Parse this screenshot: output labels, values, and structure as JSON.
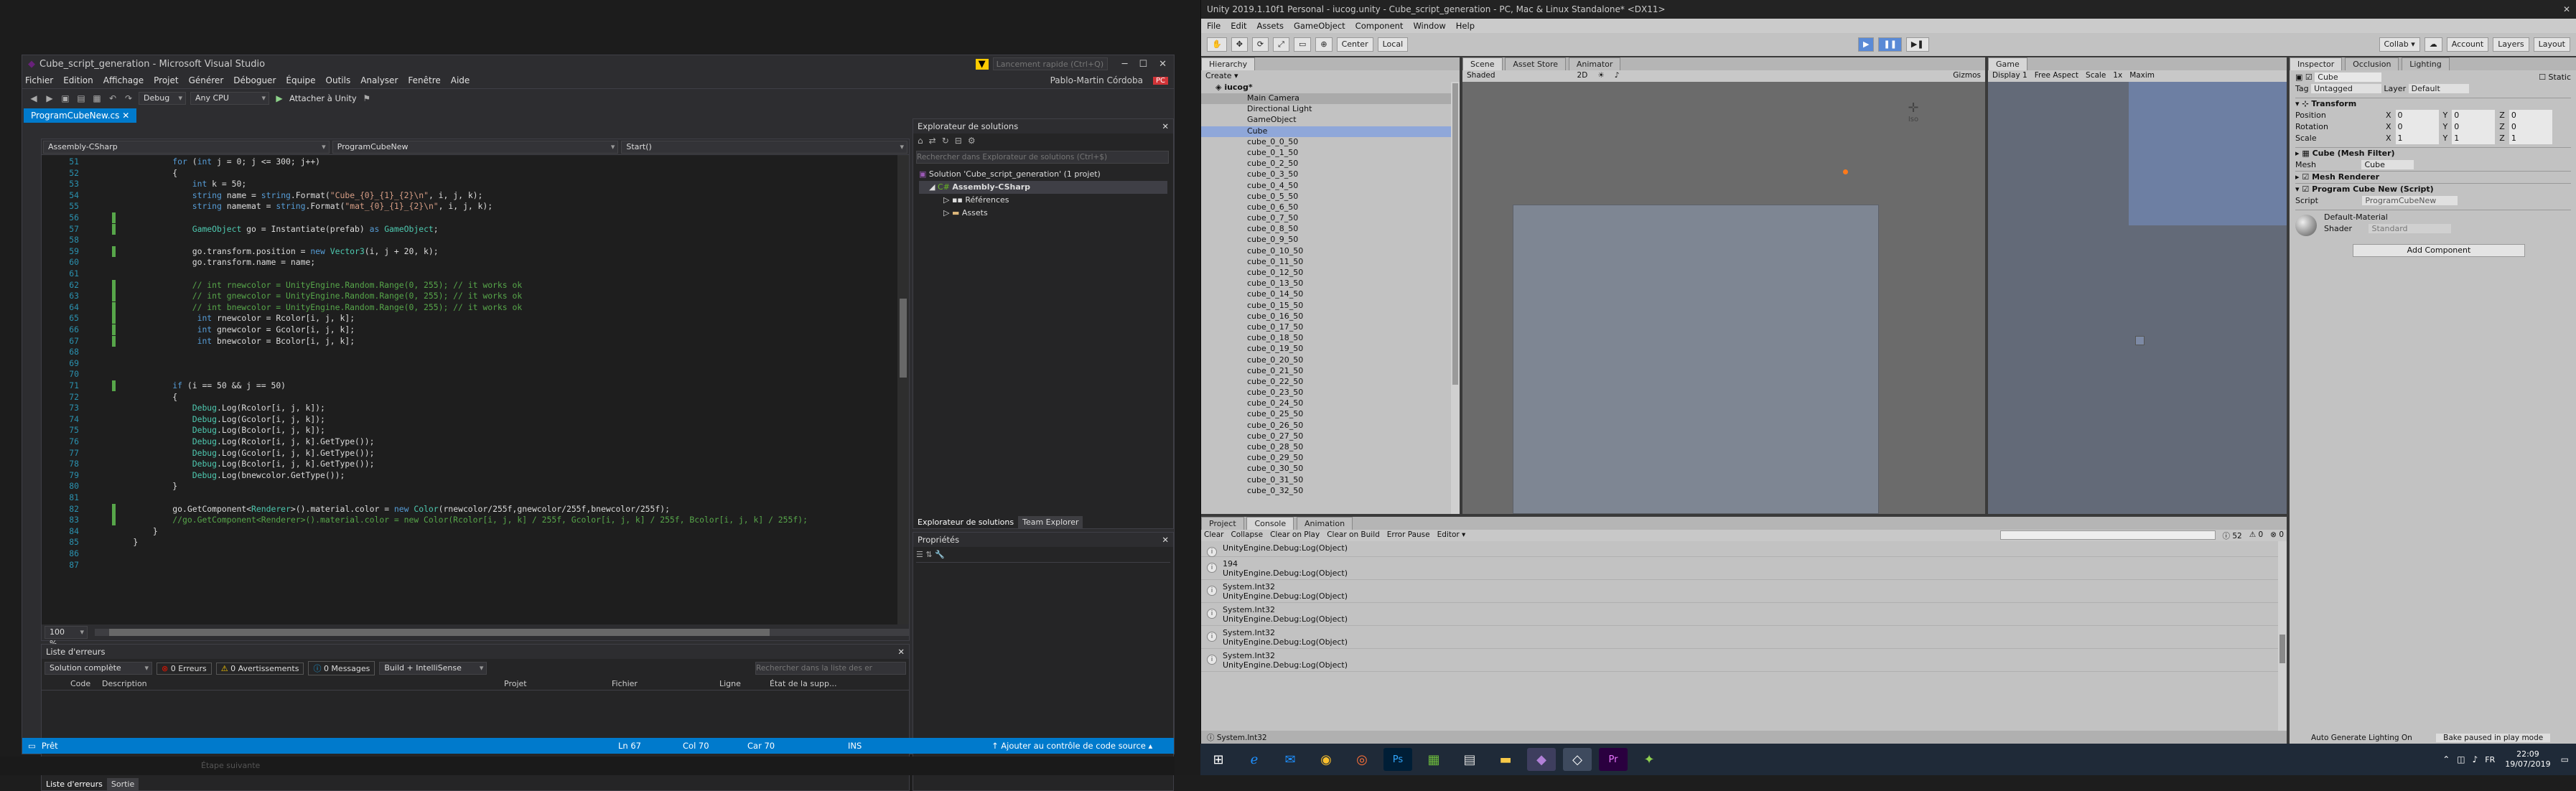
{
  "vs": {
    "title": "Cube_script_generation - Microsoft Visual Studio",
    "user": "Pablo-Martin Córdoba",
    "quicklaunch_placeholder": "Lancement rapide (Ctrl+Q)",
    "menu": [
      "Fichier",
      "Edition",
      "Affichage",
      "Projet",
      "Générer",
      "Déboguer",
      "Équipe",
      "Outils",
      "Analyser",
      "Fenêtre",
      "Aide"
    ],
    "config": "Debug",
    "platform": "Any CPU",
    "attach_label": "Attacher à Unity",
    "doc_tab": "ProgramCubeNew.cs",
    "nav": [
      "Assembly-CSharp",
      "ProgramCubeNew",
      "Start()"
    ],
    "zoom": "100 %",
    "code": [
      {
        "n": "51",
        "t": "            for (int j = 0; j <= 300; j++)"
      },
      {
        "n": "52",
        "t": "            {"
      },
      {
        "n": "53",
        "t": "                int k = 50;"
      },
      {
        "n": "54",
        "t": "                string name = string.Format(\"Cube_{0}_{1}_{2}\\n\", i, j, k);"
      },
      {
        "n": "55",
        "t": "                string namemat = string.Format(\"mat_{0}_{1}_{2}\\n\", i, j, k);"
      },
      {
        "n": "56",
        "t": ""
      },
      {
        "n": "57",
        "t": "                GameObject go = Instantiate(prefab) as GameObject;"
      },
      {
        "n": "58",
        "t": ""
      },
      {
        "n": "59",
        "t": "                go.transform.position = new Vector3(i, j + 20, k);"
      },
      {
        "n": "60",
        "t": "                go.transform.name = name;"
      },
      {
        "n": "61",
        "t": ""
      },
      {
        "n": "62",
        "t": "                // int rnewcolor = UnityEngine.Random.Range(0, 255); // it works ok"
      },
      {
        "n": "63",
        "t": "                // int gnewcolor = UnityEngine.Random.Range(0, 255); // it works ok"
      },
      {
        "n": "64",
        "t": "                // int bnewcolor = UnityEngine.Random.Range(0, 255); // it works ok"
      },
      {
        "n": "65",
        "t": "                 int rnewcolor = Rcolor[i, j, k];"
      },
      {
        "n": "66",
        "t": "                 int gnewcolor = Gcolor[i, j, k];"
      },
      {
        "n": "67",
        "t": "                 int bnewcolor = Bcolor[i, j, k];"
      },
      {
        "n": "68",
        "t": ""
      },
      {
        "n": "69",
        "t": ""
      },
      {
        "n": "70",
        "t": ""
      },
      {
        "n": "71",
        "t": "            if (i == 50 && j == 50)"
      },
      {
        "n": "72",
        "t": "            {"
      },
      {
        "n": "73",
        "t": "                Debug.Log(Rcolor[i, j, k]);"
      },
      {
        "n": "74",
        "t": "                Debug.Log(Gcolor[i, j, k]);"
      },
      {
        "n": "75",
        "t": "                Debug.Log(Bcolor[i, j, k]);"
      },
      {
        "n": "76",
        "t": "                Debug.Log(Rcolor[i, j, k].GetType());"
      },
      {
        "n": "77",
        "t": "                Debug.Log(Gcolor[i, j, k].GetType());"
      },
      {
        "n": "78",
        "t": "                Debug.Log(Bcolor[i, j, k].GetType());"
      },
      {
        "n": "79",
        "t": "                Debug.Log(bnewcolor.GetType());"
      },
      {
        "n": "80",
        "t": "            }"
      },
      {
        "n": "81",
        "t": ""
      },
      {
        "n": "82",
        "t": "            go.GetComponent<Renderer>().material.color = new Color(rnewcolor/255f,gnewcolor/255f,bnewcolor/255f);"
      },
      {
        "n": "83",
        "t": "            //go.GetComponent<Renderer>().material.color = new Color(Rcolor[i, j, k] / 255f, Gcolor[i, j, k] / 255f, Bcolor[i, j, k] / 255f);"
      },
      {
        "n": "84",
        "t": "        }"
      },
      {
        "n": "85",
        "t": "    }"
      },
      {
        "n": "86",
        "t": ""
      },
      {
        "n": "87",
        "t": ""
      }
    ],
    "errors": {
      "title": "Liste d'erreurs",
      "scope": "Solution complète",
      "err_count": "0 Erreurs",
      "warn_count": "0 Avertissements",
      "msg_count": "0 Messages",
      "build": "Build + IntelliSense",
      "search_placeholder": "Rechercher dans la liste des er",
      "columns": [
        "Code",
        "Description",
        "Projet",
        "Fichier",
        "Ligne",
        "État de la supp..."
      ],
      "bottom_tabs": [
        "Liste d'erreurs",
        "Sortie"
      ]
    },
    "solution": {
      "title": "Explorateur de solutions",
      "search_placeholder": "Rechercher dans Explorateur de solutions (Ctrl+$)",
      "items": [
        "Solution 'Cube_script_generation' (1 projet)",
        "Assembly-CSharp",
        "Références",
        "Assets"
      ],
      "bottom_tabs": [
        "Explorateur de solutions",
        "Team Explorer"
      ]
    },
    "props_title": "Propriétés",
    "status": {
      "ready": "Prêt",
      "ln": "Ln 67",
      "col": "Col 70",
      "car": "Car 70",
      "ins": "INS",
      "scm": "Ajouter au contrôle de code source"
    }
  },
  "unity": {
    "title": "Unity 2019.1.10f1 Personal - iucog.unity - Cube_script_generation - PC, Mac & Linux Standalone* <DX11>",
    "menu": [
      "File",
      "Edit",
      "Assets",
      "GameObject",
      "Component",
      "Window",
      "Help"
    ],
    "pivot": "Center",
    "space": "Local",
    "collab": "Collab ▾",
    "account": "Account",
    "layers": "Layers",
    "layout": "Layout",
    "hierarchy": {
      "tab": "Hierarchy",
      "create": "Create",
      "scene": "iucog*",
      "items": [
        "Main Camera",
        "Directional Light",
        "GameObject",
        "Cube",
        "cube_0_0_50",
        "cube_0_1_50",
        "cube_0_2_50",
        "cube_0_3_50",
        "cube_0_4_50",
        "cube_0_5_50",
        "cube_0_6_50",
        "cube_0_7_50",
        "cube_0_8_50",
        "cube_0_9_50",
        "cube_0_10_50",
        "cube_0_11_50",
        "cube_0_12_50",
        "cube_0_13_50",
        "cube_0_14_50",
        "cube_0_15_50",
        "cube_0_16_50",
        "cube_0_17_50",
        "cube_0_18_50",
        "cube_0_19_50",
        "cube_0_20_50",
        "cube_0_21_50",
        "cube_0_22_50",
        "cube_0_23_50",
        "cube_0_24_50",
        "cube_0_25_50",
        "cube_0_26_50",
        "cube_0_27_50",
        "cube_0_28_50",
        "cube_0_29_50",
        "cube_0_30_50",
        "cube_0_31_50",
        "cube_0_32_50"
      ]
    },
    "scene_tabs": [
      "Scene",
      "Asset Store",
      "Animator"
    ],
    "scene_shading": "Shaded",
    "scene_2d": "2D",
    "gizmos": "Gizmos",
    "persp": "Iso",
    "game": {
      "tab": "Game",
      "display": "Display 1",
      "aspect": "Free Aspect",
      "scale": "Scale",
      "scale_val": "1x",
      "maximize": "Maxim"
    },
    "inspector": {
      "tabs": [
        "Inspector",
        "Occlusion",
        "Lighting"
      ],
      "name": "Cube",
      "static": "Static",
      "tag": "Untagged",
      "layer": "Default",
      "transform": "Transform",
      "rows": [
        {
          "label": "Position",
          "x": "0",
          "y": "0",
          "z": "0"
        },
        {
          "label": "Rotation",
          "x": "0",
          "y": "0",
          "z": "0"
        },
        {
          "label": "Scale",
          "x": "1",
          "y": "1",
          "z": "1"
        }
      ],
      "mesh_filter": "Cube (Mesh Filter)",
      "mesh_label": "Mesh",
      "mesh_value": "Cube",
      "renderer": "Mesh Renderer",
      "script_comp": "Program Cube New (Script)",
      "script_label": "Script",
      "script_value": "ProgramCubeNew",
      "material": "Default-Material",
      "shader_label": "Shader",
      "shader_value": "Standard",
      "add_component": "Add Component",
      "status": "Auto Generate Lighting On",
      "bake": "Bake paused in play mode"
    },
    "console": {
      "tabs": [
        "Project",
        "Console",
        "Animation"
      ],
      "buttons": [
        "Clear",
        "Collapse",
        "Clear on Play",
        "Clear on Build",
        "Error Pause",
        "Editor ▾"
      ],
      "counts": [
        "52",
        "0",
        "0"
      ],
      "rows": [
        {
          "a": "UnityEngine.Debug:Log(Object)",
          "b": ""
        },
        {
          "a": "194",
          "b": "UnityEngine.Debug:Log(Object)"
        },
        {
          "a": "System.Int32",
          "b": "UnityEngine.Debug:Log(Object)"
        },
        {
          "a": "System.Int32",
          "b": "UnityEngine.Debug:Log(Object)"
        },
        {
          "a": "System.Int32",
          "b": "UnityEngine.Debug:Log(Object)"
        },
        {
          "a": "System.Int32",
          "b": "UnityEngine.Debug:Log(Object)"
        }
      ],
      "status": "System.Int32"
    }
  },
  "taskbar": {
    "lang": "FR",
    "time": "22:09",
    "date": "19/07/2019"
  },
  "desktop_labels": [
    "Étape suivante"
  ]
}
